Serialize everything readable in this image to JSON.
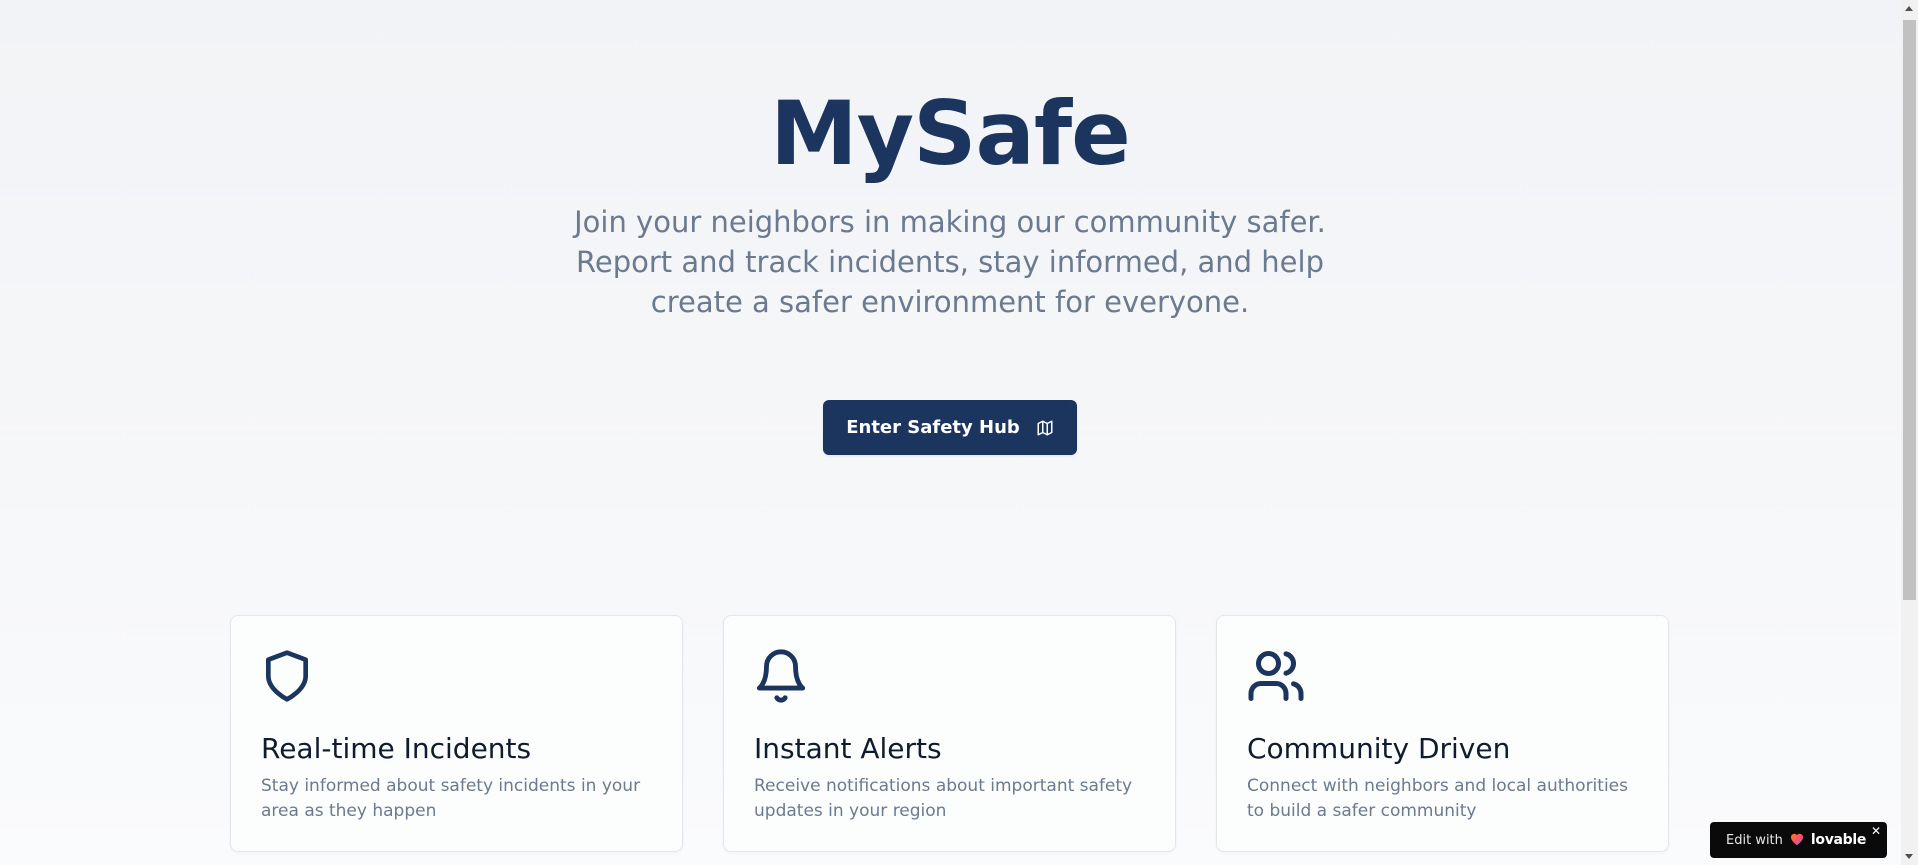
{
  "hero": {
    "title": "MySafe",
    "subtitle": "Join your neighbors in making our community safer. Report and track incidents, stay informed, and help create a safer environment for everyone.",
    "cta_label": "Enter Safety Hub"
  },
  "features": [
    {
      "icon": "shield-icon",
      "title": "Real-time Incidents",
      "description": "Stay informed about safety incidents in your area as they happen"
    },
    {
      "icon": "bell-icon",
      "title": "Instant Alerts",
      "description": "Receive notifications about important safety updates in your region"
    },
    {
      "icon": "users-icon",
      "title": "Community Driven",
      "description": "Connect with neighbors and local authorities to build a safer community"
    }
  ],
  "badge": {
    "prefix": "Edit with",
    "brand": "lovable",
    "close": "✕"
  },
  "colors": {
    "brand": "#1c355e",
    "muted_text": "#6b7a8f",
    "heading_text": "#0f1c2e"
  }
}
